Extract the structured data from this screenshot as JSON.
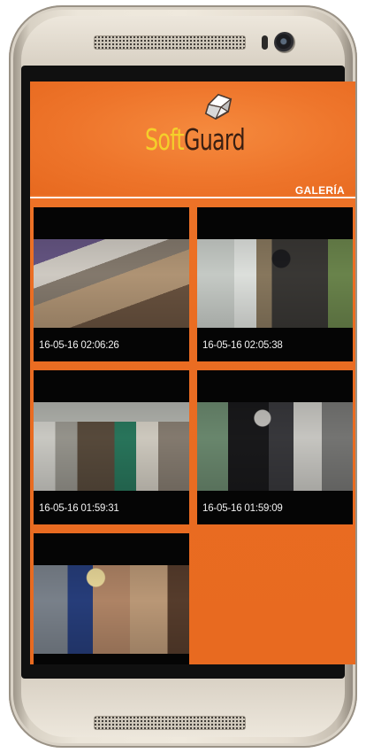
{
  "app": {
    "logo_soft": "Soft",
    "logo_guard": "Guard",
    "brand_colors": {
      "orange": "#ee722a",
      "yellow": "#f4cf2b",
      "dark_brown": "#3a1f12"
    }
  },
  "header": {
    "section_title": "GALERÍA"
  },
  "gallery": {
    "items": [
      {
        "timestamp": "16-05-16 02:06:26",
        "icon": "image-thumbnail"
      },
      {
        "timestamp": "16-05-16 02:05:38",
        "icon": "image-thumbnail"
      },
      {
        "timestamp": "16-05-16 01:59:31",
        "icon": "image-thumbnail"
      },
      {
        "timestamp": "16-05-16 01:59:09",
        "icon": "image-thumbnail"
      },
      {
        "timestamp": "",
        "icon": "image-thumbnail"
      }
    ]
  }
}
